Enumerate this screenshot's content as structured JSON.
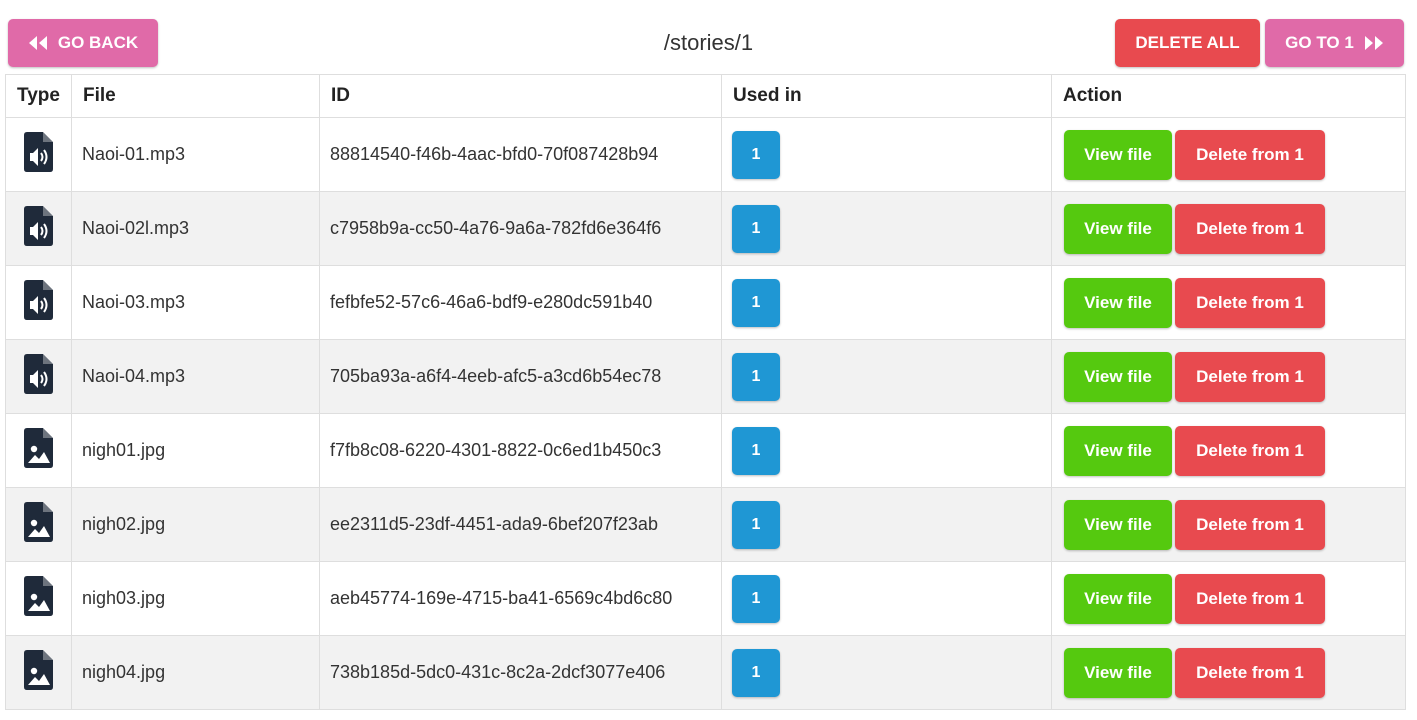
{
  "header": {
    "back_label": "GO BACK",
    "path": "/stories/1",
    "delete_all_label": "DELETE ALL",
    "goto_label": "GO TO 1"
  },
  "table": {
    "columns": [
      "Type",
      "File",
      "ID",
      "Used in",
      "Action"
    ],
    "rows": [
      {
        "type": "audio-file",
        "file": "Naoi-01.mp3",
        "id": "88814540-f46b-4aac-bfd0-70f087428b94",
        "used_in": "1",
        "view_label": "View file",
        "delete_label": "Delete from 1"
      },
      {
        "type": "audio-file",
        "file": "Naoi-02l.mp3",
        "id": "c7958b9a-cc50-4a76-9a6a-782fd6e364f6",
        "used_in": "1",
        "view_label": "View file",
        "delete_label": "Delete from 1"
      },
      {
        "type": "audio-file",
        "file": "Naoi-03.mp3",
        "id": "fefbfe52-57c6-46a6-bdf9-e280dc591b40",
        "used_in": "1",
        "view_label": "View file",
        "delete_label": "Delete from 1"
      },
      {
        "type": "audio-file",
        "file": "Naoi-04.mp3",
        "id": "705ba93a-a6f4-4eeb-afc5-a3cd6b54ec78",
        "used_in": "1",
        "view_label": "View file",
        "delete_label": "Delete from 1"
      },
      {
        "type": "image-file",
        "file": "nigh01.jpg",
        "id": "f7fb8c08-6220-4301-8822-0c6ed1b450c3",
        "used_in": "1",
        "view_label": "View file",
        "delete_label": "Delete from 1"
      },
      {
        "type": "image-file",
        "file": "nigh02.jpg",
        "id": "ee2311d5-23df-4451-ada9-6bef207f23ab",
        "used_in": "1",
        "view_label": "View file",
        "delete_label": "Delete from 1"
      },
      {
        "type": "image-file",
        "file": "nigh03.jpg",
        "id": "aeb45774-169e-4715-ba41-6569c4bd6c80",
        "used_in": "1",
        "view_label": "View file",
        "delete_label": "Delete from 1"
      },
      {
        "type": "image-file",
        "file": "nigh04.jpg",
        "id": "738b185d-5dc0-431c-8c2a-2dcf3077e406",
        "used_in": "1",
        "view_label": "View file",
        "delete_label": "Delete from 1"
      }
    ]
  },
  "colors": {
    "pink": "#e06aa8",
    "red": "#e84a4f",
    "green": "#55c90f",
    "blue": "#1f97d4",
    "icon": "#1f2a3a"
  }
}
